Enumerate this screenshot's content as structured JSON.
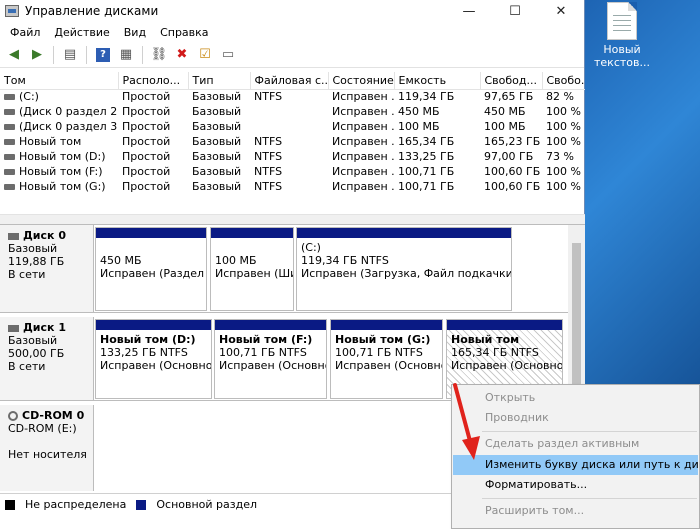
{
  "desktop": {
    "icon_label": "Новый текстов..."
  },
  "window": {
    "title": "Управление дисками",
    "minimize": "—",
    "maximize": "☐",
    "close": "✕"
  },
  "menu": [
    "Файл",
    "Действие",
    "Вид",
    "Справка"
  ],
  "table": {
    "headers": [
      "Том",
      "Располо...",
      "Тип",
      "Файловая с...",
      "Состояние",
      "Емкость",
      "Свобод...",
      "Свобо..."
    ],
    "rows": [
      [
        "(C:)",
        "Простой",
        "Базовый",
        "NTFS",
        "Исправен ...",
        "119,34 ГБ",
        "97,65 ГБ",
        "82 %"
      ],
      [
        "(Диск 0 раздел 2)",
        "Простой",
        "Базовый",
        "",
        "Исправен ...",
        "450 МБ",
        "450 МБ",
        "100 %"
      ],
      [
        "(Диск 0 раздел 3)",
        "Простой",
        "Базовый",
        "",
        "Исправен ...",
        "100 МБ",
        "100 МБ",
        "100 %"
      ],
      [
        "Новый том",
        "Простой",
        "Базовый",
        "NTFS",
        "Исправен ...",
        "165,34 ГБ",
        "165,23 ГБ",
        "100 %"
      ],
      [
        "Новый том (D:)",
        "Простой",
        "Базовый",
        "NTFS",
        "Исправен ...",
        "133,25 ГБ",
        "97,00 ГБ",
        "73 %"
      ],
      [
        "Новый том (F:)",
        "Простой",
        "Базовый",
        "NTFS",
        "Исправен ...",
        "100,71 ГБ",
        "100,60 ГБ",
        "100 %"
      ],
      [
        "Новый том (G:)",
        "Простой",
        "Базовый",
        "NTFS",
        "Исправен ...",
        "100,71 ГБ",
        "100,60 ГБ",
        "100 %"
      ]
    ]
  },
  "disks": [
    {
      "name": "Диск 0",
      "type": "Базовый",
      "size": "119,88 ГБ",
      "status": "В сети",
      "partitions": [
        {
          "title": "",
          "size": "450 МБ",
          "status": "Исправен (Раздел в"
        },
        {
          "title": "",
          "size": "100 МБ",
          "status": "Исправен (Ши"
        },
        {
          "title": "(C:)",
          "size": "119,34 ГБ NTFS",
          "status": "Исправен (Загрузка, Файл подкачки, Ава"
        }
      ]
    },
    {
      "name": "Диск 1",
      "type": "Базовый",
      "size": "500,00 ГБ",
      "status": "В сети",
      "partitions": [
        {
          "title": "Новый том  (D:)",
          "size": "133,25 ГБ NTFS",
          "status": "Исправен (Основной"
        },
        {
          "title": "Новый том  (F:)",
          "size": "100,71 ГБ NTFS",
          "status": "Исправен (Основно"
        },
        {
          "title": "Новый том  (G:)",
          "size": "100,71 ГБ NTFS",
          "status": "Исправен (Основно"
        },
        {
          "title": "Новый том",
          "size": "165,34 ГБ NTFS",
          "status": "Исправен (Основной"
        }
      ]
    },
    {
      "name": "CD-ROM 0",
      "type": "CD-ROM (E:)",
      "size": "",
      "status": "Нет носителя"
    }
  ],
  "legend": {
    "unallocated": "Не распределена",
    "primary": "Основной раздел",
    "unallocated_color": "#000000",
    "primary_color": "#0a1a84"
  },
  "context_menu": {
    "items": [
      {
        "label": "Открыть",
        "disabled": true
      },
      {
        "label": "Проводник",
        "disabled": true
      },
      {
        "label": "Сделать раздел активным",
        "disabled": true
      },
      {
        "label": "Изменить букву диска или путь к диску...",
        "disabled": false,
        "highlighted": true
      },
      {
        "label": "Форматировать...",
        "disabled": false
      },
      {
        "label": "Расширить том...",
        "disabled": true
      }
    ]
  },
  "colors": {
    "accent": "#0a1a84",
    "highlight": "#91c9f7",
    "annotation_arrow": "#e0231c"
  }
}
